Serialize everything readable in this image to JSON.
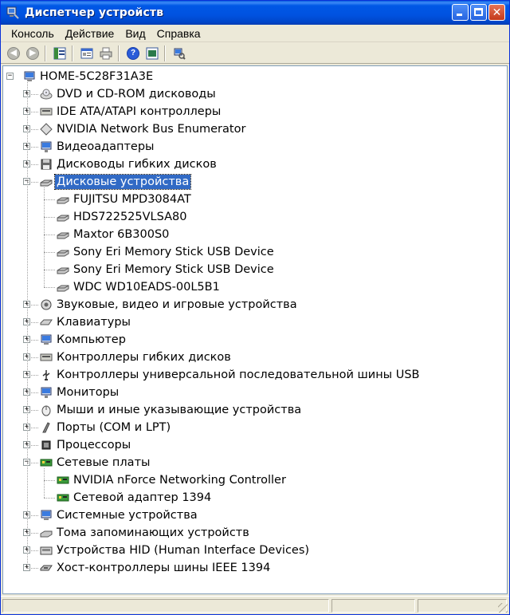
{
  "window": {
    "title": "Диспетчер устройств"
  },
  "menu": [
    "Консоль",
    "Действие",
    "Вид",
    "Справка"
  ],
  "toolbar": {
    "icons": [
      "back-icon",
      "forward-icon",
      "tree-view-icon",
      "properties-icon",
      "print-icon",
      "help-icon",
      "view-icon",
      "scan-hardware-icon"
    ]
  },
  "tree": {
    "root": "HOME-5C28F31A3E",
    "categories": [
      {
        "label": "DVD и CD-ROM дисководы",
        "icon": "cdrom-icon",
        "expanded": false
      },
      {
        "label": "IDE ATA/ATAPI контроллеры",
        "icon": "ide-controller-icon",
        "expanded": false
      },
      {
        "label": "NVIDIA Network Bus Enumerator",
        "icon": "bus-enumerator-icon",
        "expanded": false
      },
      {
        "label": "Видеоадаптеры",
        "icon": "display-adapter-icon",
        "expanded": false
      },
      {
        "label": "Дисководы гибких дисков",
        "icon": "floppy-drive-icon",
        "expanded": false
      },
      {
        "label": "Дисковые устройства",
        "icon": "disk-drive-icon",
        "expanded": true,
        "selected": true,
        "children": [
          "FUJITSU MPD3084AT",
          "HDS722525VLSA80",
          "Maxtor 6B300S0",
          "Sony Eri Memory Stick USB Device",
          "Sony Eri Memory Stick USB Device",
          "WDC WD10EADS-00L5B1"
        ],
        "child_icon": "hard-disk-icon"
      },
      {
        "label": "Звуковые, видео и игровые устройства",
        "icon": "sound-icon",
        "expanded": false
      },
      {
        "label": "Клавиатуры",
        "icon": "keyboard-icon",
        "expanded": false
      },
      {
        "label": "Компьютер",
        "icon": "computer-icon",
        "expanded": false
      },
      {
        "label": "Контроллеры гибких дисков",
        "icon": "floppy-controller-icon",
        "expanded": false
      },
      {
        "label": "Контроллеры универсальной последовательной шины USB",
        "icon": "usb-icon",
        "expanded": false
      },
      {
        "label": "Мониторы",
        "icon": "monitor-icon",
        "expanded": false
      },
      {
        "label": "Мыши и иные указывающие устройства",
        "icon": "mouse-icon",
        "expanded": false
      },
      {
        "label": "Порты (COM и LPT)",
        "icon": "port-icon",
        "expanded": false
      },
      {
        "label": "Процессоры",
        "icon": "processor-icon",
        "expanded": false
      },
      {
        "label": "Сетевые платы",
        "icon": "network-card-icon",
        "expanded": true,
        "children": [
          "NVIDIA nForce Networking Controller",
          "Сетевой адаптер 1394"
        ],
        "child_icon": "network-adapter-icon"
      },
      {
        "label": "Системные устройства",
        "icon": "system-device-icon",
        "expanded": false
      },
      {
        "label": "Тома запоминающих устройств",
        "icon": "storage-volume-icon",
        "expanded": false
      },
      {
        "label": "Устройства HID (Human Interface Devices)",
        "icon": "hid-icon",
        "expanded": false
      },
      {
        "label": "Хост-контроллеры шины IEEE 1394",
        "icon": "ieee1394-icon",
        "expanded": false
      }
    ]
  },
  "colors": {
    "titlebar": "#0058e6",
    "selection": "#316ac5",
    "chrome": "#ece9d8"
  }
}
